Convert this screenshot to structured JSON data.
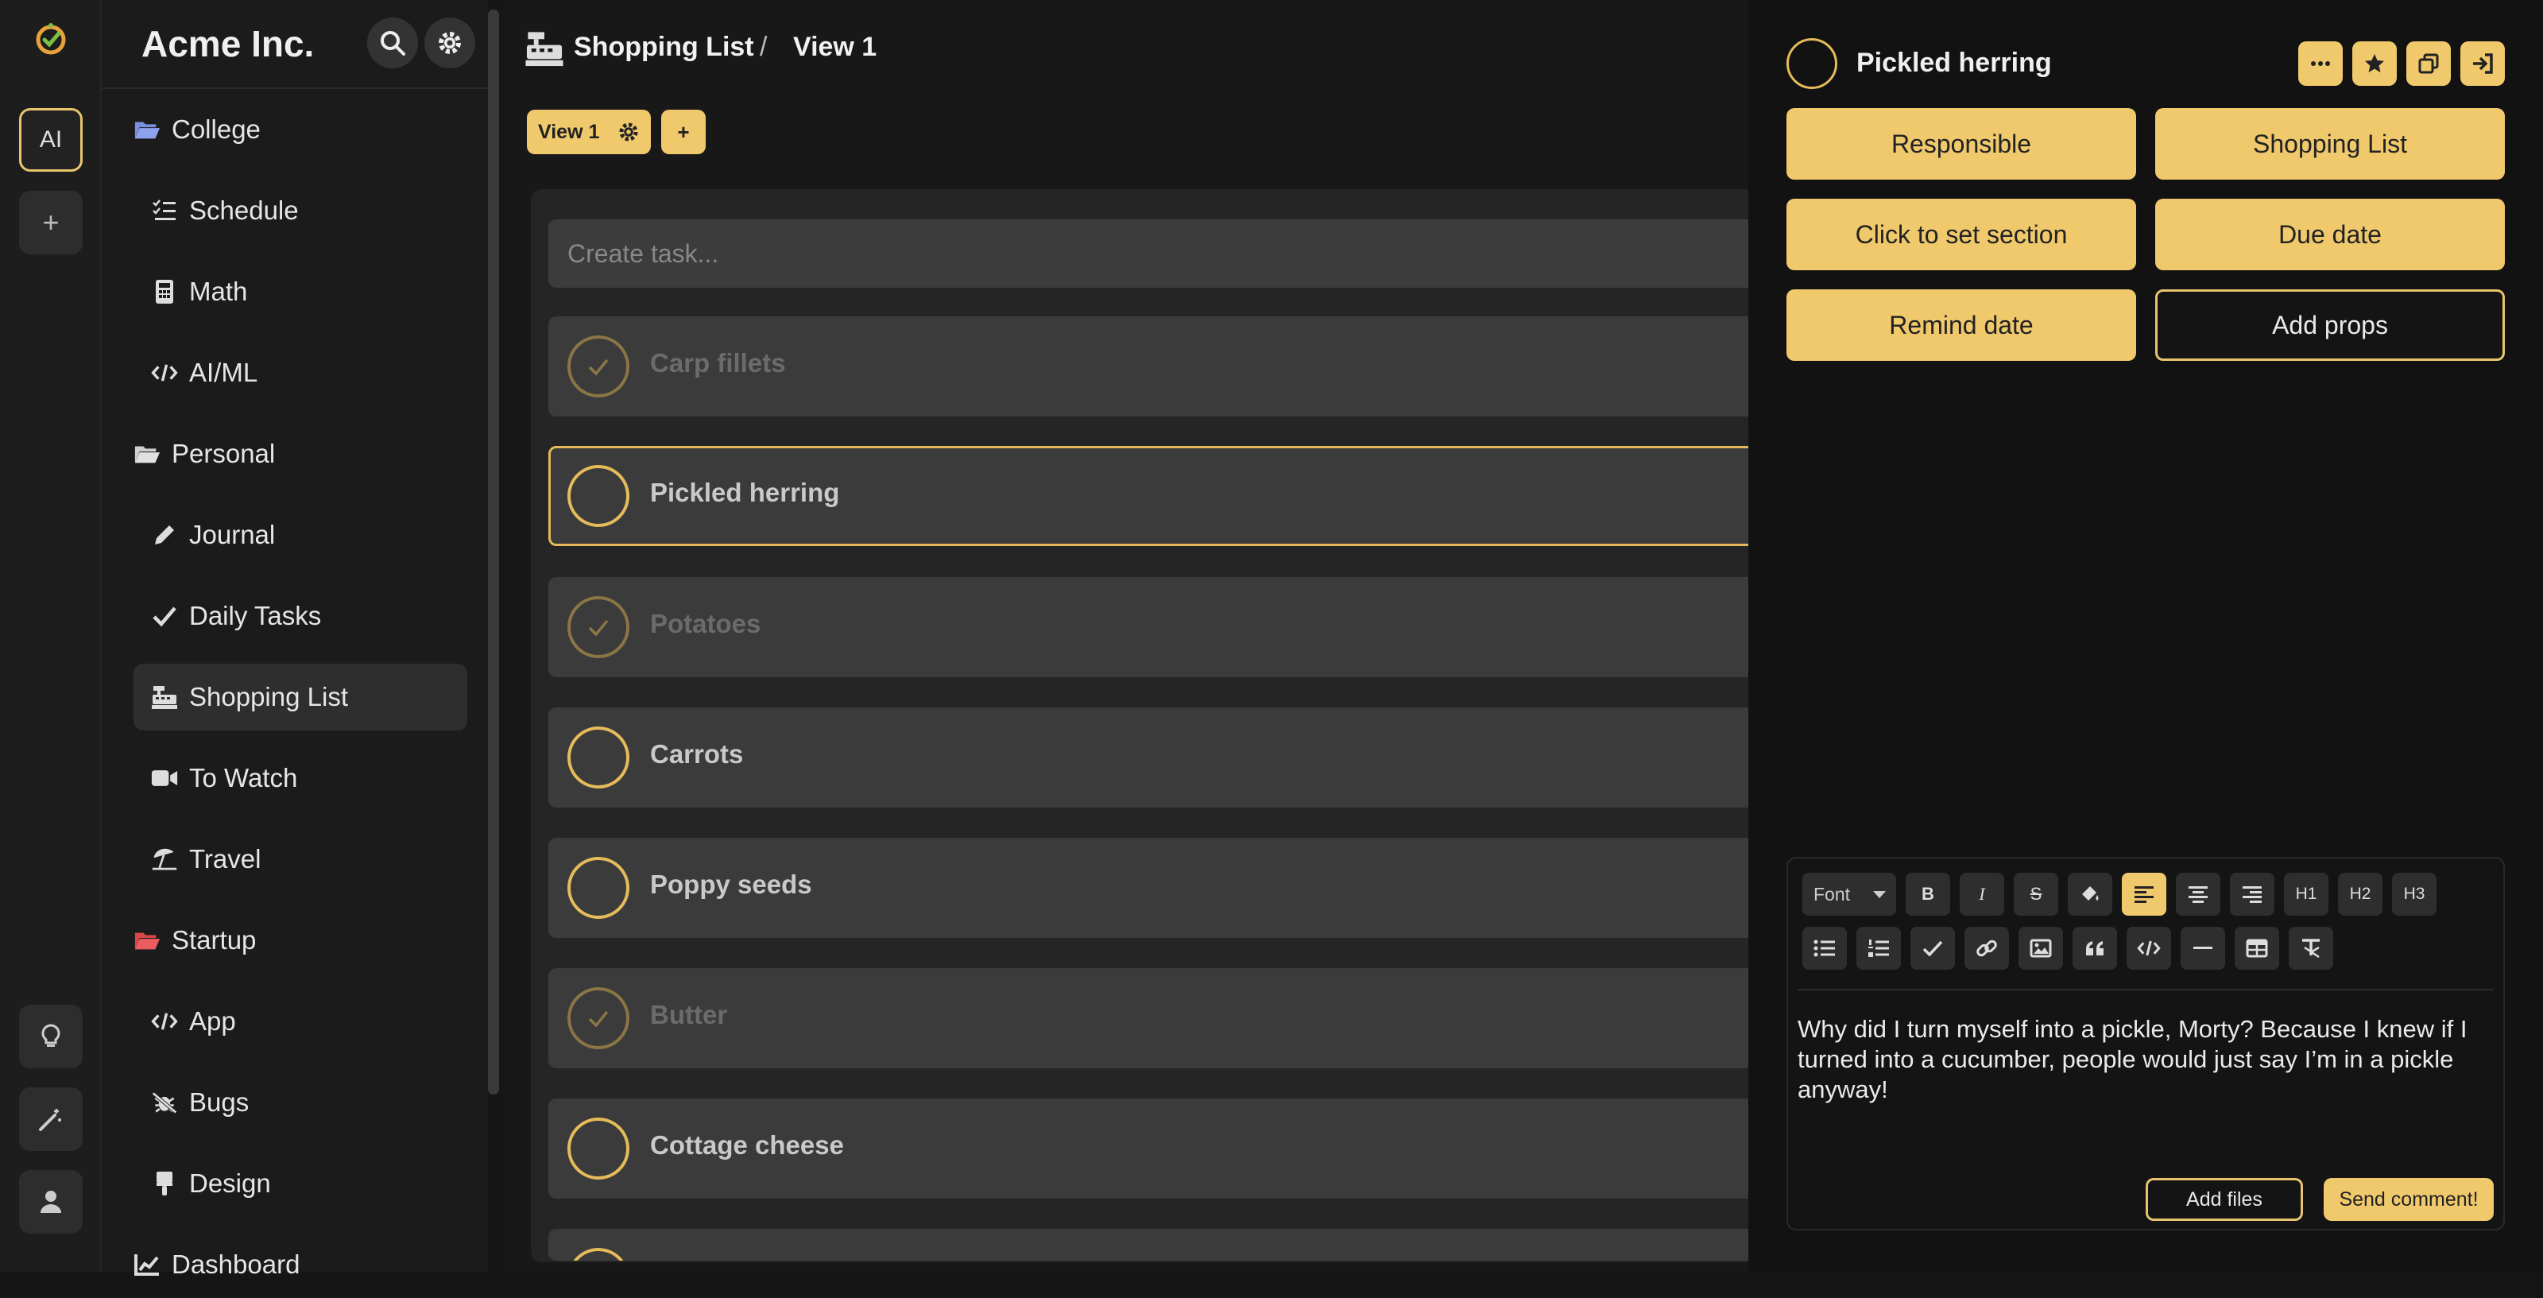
{
  "app": {
    "name": "Acme Inc.",
    "workspace_initials": "AI"
  },
  "rail": {
    "add_label": "+"
  },
  "sidebar": {
    "items": [
      {
        "label": "College",
        "icon": "folder-open-icon"
      },
      {
        "label": "Schedule",
        "icon": "list-check-icon"
      },
      {
        "label": "Math",
        "icon": "calculator-icon"
      },
      {
        "label": "AI/ML",
        "icon": "code-icon"
      },
      {
        "label": "Personal",
        "icon": "folder-open-icon"
      },
      {
        "label": "Journal",
        "icon": "pencil-icon"
      },
      {
        "label": "Daily Tasks",
        "icon": "check-icon"
      },
      {
        "label": "Shopping List",
        "icon": "cash-register-icon"
      },
      {
        "label": "To Watch",
        "icon": "video-icon"
      },
      {
        "label": "Travel",
        "icon": "umbrella-beach-icon"
      },
      {
        "label": "Startup",
        "icon": "folder-open-icon"
      },
      {
        "label": "App",
        "icon": "code-icon"
      },
      {
        "label": "Bugs",
        "icon": "bug-slash-icon"
      },
      {
        "label": "Design",
        "icon": "brush-icon"
      },
      {
        "label": "Dashboard",
        "icon": "chart-icon"
      }
    ]
  },
  "header": {
    "project": "Shopping List",
    "separator": "/",
    "view": "View 1"
  },
  "views": {
    "active": "View 1",
    "add_label": "+"
  },
  "list": {
    "create_placeholder": "Create task...",
    "tasks": [
      {
        "name": "Carp fillets",
        "done": true
      },
      {
        "name": "Pickled herring",
        "done": false
      },
      {
        "name": "Potatoes",
        "done": true
      },
      {
        "name": "Carrots",
        "done": false
      },
      {
        "name": "Poppy seeds",
        "done": false
      },
      {
        "name": "Butter",
        "done": true
      },
      {
        "name": "Cottage cheese",
        "done": false
      }
    ]
  },
  "detail": {
    "title": "Pickled herring",
    "buttons": {
      "responsible": "Responsible",
      "project": "Shopping List",
      "section": "Click to set section",
      "due": "Due date",
      "remind": "Remind date",
      "props": "Add props"
    },
    "toolbar": {
      "font": "Font",
      "h1": "H1",
      "h2": "H2",
      "h3": "H3",
      "bold": "B",
      "italic": "I",
      "strike": "S"
    },
    "comment_text": "Why did I turn myself into a pickle, Morty? Because I knew if I turned into a cucumber, people would just say I’m in a pickle anyway!",
    "add_files": "Add files",
    "send": "Send comment!"
  },
  "colors": {
    "accent": "#f0c96c",
    "background": "#151515",
    "panel": "#252525",
    "task": "#3b3b3b"
  }
}
